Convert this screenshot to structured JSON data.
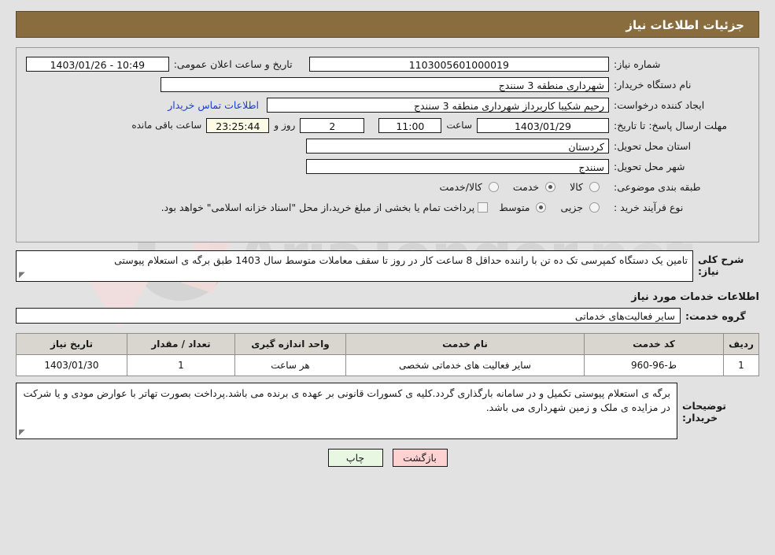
{
  "header": {
    "title": "جزئیات اطلاعات نیاز",
    "bar_color": "#8a6d3f"
  },
  "form": {
    "need_number_label": "شماره نیاز:",
    "need_number_value": "1103005601000019",
    "announce_label": "تاریخ و ساعت اعلان عمومی:",
    "announce_value": "1403/01/26 - 10:49",
    "buyer_org_label": "نام دستگاه خریدار:",
    "buyer_org_value": "شهرداری منطقه 3 سنندج",
    "creator_label": "ایجاد کننده درخواست:",
    "creator_value": "رحیم شکیبا کاربرداز شهرداری منطقه 3 سنندج",
    "contact_link": "اطلاعات تماس خریدار",
    "deadline_label": "مهلت ارسال پاسخ: تا تاریخ:",
    "deadline_date": "1403/01/29",
    "hour_label": "ساعت",
    "deadline_time": "11:00",
    "days_value": "2",
    "days_label": "روز و",
    "countdown_value": "23:25:44",
    "countdown_label": "ساعت باقی مانده",
    "province_label": "استان محل تحویل:",
    "province_value": "کردستان",
    "city_label": "شهر محل تحویل:",
    "city_value": "سنندج",
    "category_label": "طبقه بندی موضوعی:",
    "category_options": [
      {
        "label": "کالا",
        "checked": false
      },
      {
        "label": "خدمت",
        "checked": true
      },
      {
        "label": "کالا/خدمت",
        "checked": false
      }
    ],
    "process_label": "نوع فرآیند خرید :",
    "process_options": [
      {
        "label": "جزیی",
        "checked": false
      },
      {
        "label": "متوسط",
        "checked": true
      }
    ],
    "treasury_checkbox_checked": false,
    "treasury_note": "پرداخت تمام یا بخشی از مبلغ خرید،از محل \"اسناد خزانه اسلامی\" خواهد بود."
  },
  "description": {
    "label": "شرح کلی نیاز:",
    "value": "تامین یک دستگاه کمپرسی تک ده تن با راننده  حداقل 8 ساعت کار در روز تا سقف معاملات متوسط سال 1403 طبق برگه ی استعلام پیوستی"
  },
  "services": {
    "section_title": "اطلاعات خدمات مورد نیاز",
    "group_label": "گروه خدمت:",
    "group_value": "سایر فعالیت‌های خدماتی",
    "table": {
      "columns": [
        "ردیف",
        "کد خدمت",
        "نام خدمت",
        "واحد اندازه گیری",
        "تعداد / مقدار",
        "تاریخ نیاز"
      ],
      "rows": [
        {
          "index": "1",
          "code": "ط-96-960",
          "name": "سایر فعالیت های خدماتی شخصی",
          "unit": "هر ساعت",
          "quantity": "1",
          "need_date": "1403/01/30"
        }
      ]
    }
  },
  "buyer_notes": {
    "label": "توضیحات خریدار:",
    "value": "برگه ی استعلام پیوستی تکمیل و در سامانه بارگذاری گردد.کلیه ی کسورات قانونی بر عهده ی برنده می باشد.پرداخت بصورت تهاتر با عوارض مودی و یا شرکت در مزایده ی ملک و زمین شهرداری می باشد."
  },
  "buttons": {
    "back": "بازگشت",
    "print": "چاپ"
  },
  "watermark": {
    "text_primary": "AriaTender",
    "text_suffix": ".net"
  }
}
